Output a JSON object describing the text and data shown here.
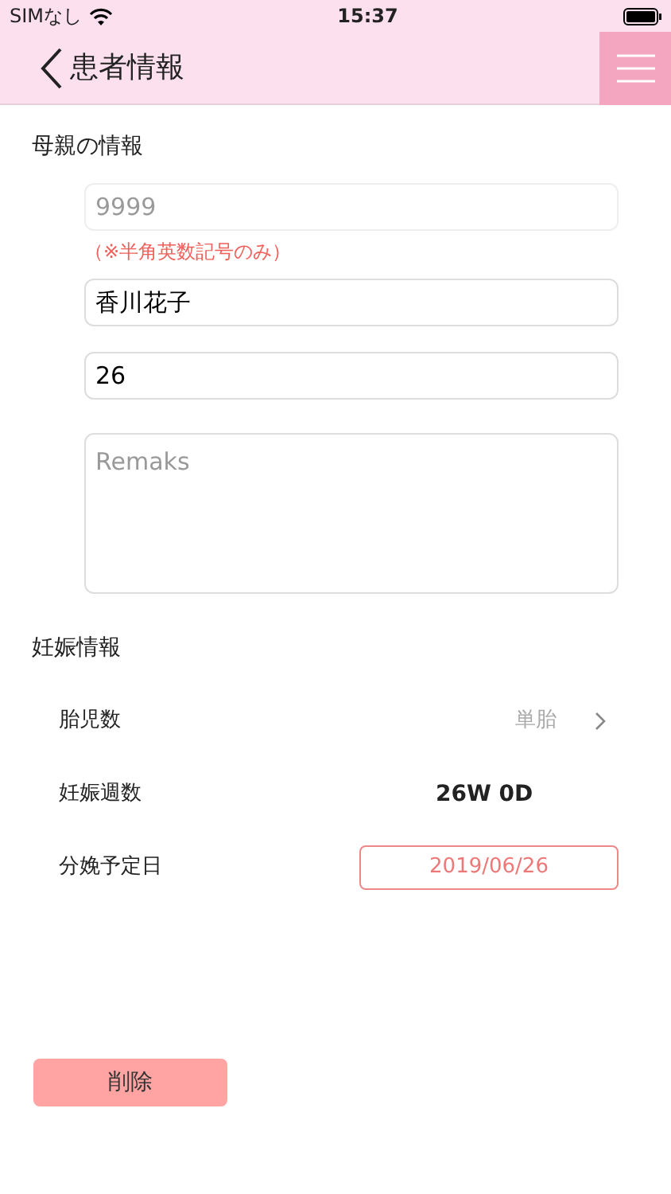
{
  "status_bar": {
    "carrier": "SIMなし",
    "time": "15:37"
  },
  "nav": {
    "title": "患者情報"
  },
  "mother": {
    "heading": "母親の情報",
    "id_field": {
      "placeholder": "9999",
      "note": "（※半角英数記号のみ）"
    },
    "name_field": {
      "value": "香川花子"
    },
    "age_field": {
      "value": "26"
    },
    "remarks": {
      "placeholder": "Remaks"
    }
  },
  "pregnancy": {
    "heading": "妊娠情報",
    "rows": [
      {
        "kind": "select",
        "label": "胎児数",
        "value": "単胎"
      },
      {
        "kind": "text",
        "label": "妊娠週数",
        "value": "26W 0D"
      },
      {
        "kind": "date",
        "label": "分娩予定日",
        "value": "2019/06/26"
      }
    ]
  },
  "delete_button": "削除"
}
